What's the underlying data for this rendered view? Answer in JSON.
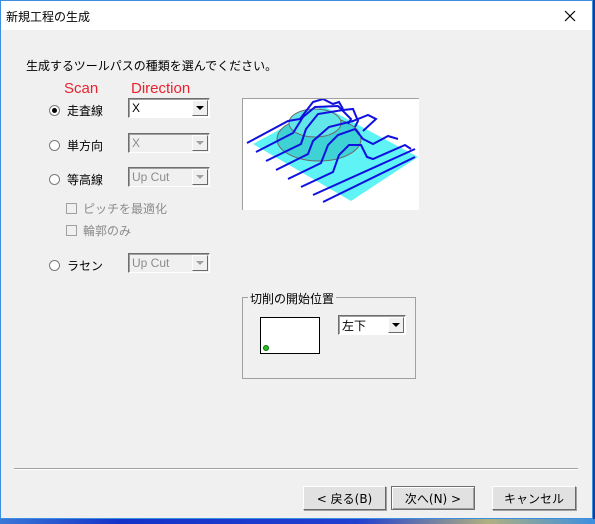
{
  "window": {
    "title": "新規工程の生成",
    "close_icon": "close-icon"
  },
  "instruction": "生成するツールパスの種類を選んでください。",
  "annotations": {
    "scan": "Scan",
    "direction": "Direction",
    "color": "#e8232e"
  },
  "scan_types": [
    {
      "label": "走査線",
      "selected": true,
      "direction": "X",
      "enabled": true
    },
    {
      "label": "単方向",
      "selected": false,
      "direction": "X",
      "enabled": false
    },
    {
      "label": "等高線",
      "selected": false,
      "direction": "Up Cut",
      "enabled": false
    },
    {
      "label": "ラセン",
      "selected": false,
      "direction": "Up Cut",
      "enabled": false
    }
  ],
  "contour_options": [
    {
      "label": "ピッチを最適化",
      "checked": false,
      "enabled": false
    },
    {
      "label": "輪郭のみ",
      "checked": false,
      "enabled": false
    }
  ],
  "preview": {
    "icon": "toolpath-preview-image",
    "surface_color": "#5ff3f5",
    "path_color": "#1010e0"
  },
  "start_position": {
    "group_label": "切削の開始位置",
    "value": "左下",
    "marker_color": "#22c020"
  },
  "buttons": {
    "back": "< 戻る(B)",
    "next": "次へ(N) >",
    "cancel": "キャンセル"
  }
}
